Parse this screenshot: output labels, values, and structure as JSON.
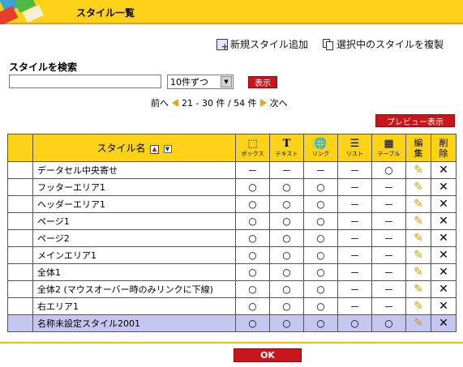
{
  "header": {
    "title": "スタイル一覧"
  },
  "top_links": {
    "add_new": "新規スタイル追加",
    "duplicate": "選択中のスタイルを複製"
  },
  "search": {
    "label": "スタイルを検索",
    "input_value": "",
    "per_page": "10件ずつ",
    "display_button": "表示"
  },
  "pager": {
    "prev": "前へ",
    "range": "21 - 30 件 / 54 件",
    "next": "次へ"
  },
  "preview_button": "プレビュー表示",
  "table": {
    "headers": {
      "name": "スタイル名",
      "box": "ボックス",
      "text": "テキスト",
      "link": "リンク",
      "list": "リスト",
      "table": "テーブル",
      "edit": "編集",
      "delete": "削除"
    },
    "rows": [
      {
        "name": "データセル中央寄せ",
        "box": "－",
        "text": "－",
        "link": "－",
        "list": "－",
        "table": "○"
      },
      {
        "name": "フッターエリア1",
        "box": "○",
        "text": "○",
        "link": "○",
        "list": "－",
        "table": "－"
      },
      {
        "name": "ヘッダーエリア1",
        "box": "○",
        "text": "○",
        "link": "○",
        "list": "－",
        "table": "－"
      },
      {
        "name": "ページ1",
        "box": "○",
        "text": "○",
        "link": "○",
        "list": "－",
        "table": "－"
      },
      {
        "name": "ページ2",
        "box": "○",
        "text": "○",
        "link": "○",
        "list": "－",
        "table": "－"
      },
      {
        "name": "メインエリア1",
        "box": "○",
        "text": "○",
        "link": "○",
        "list": "－",
        "table": "－"
      },
      {
        "name": "全体1",
        "box": "○",
        "text": "○",
        "link": "○",
        "list": "－",
        "table": "－"
      },
      {
        "name": "全体2 (マウスオーバー時のみリンクに下線)",
        "box": "○",
        "text": "○",
        "link": "○",
        "list": "－",
        "table": "－"
      },
      {
        "name": "右エリア1",
        "box": "○",
        "text": "○",
        "link": "○",
        "list": "－",
        "table": "－"
      },
      {
        "name": "名称未設定スタイル2001",
        "box": "○",
        "text": "○",
        "link": "○",
        "list": "○",
        "table": "○"
      }
    ]
  },
  "ok_button": "OK",
  "colors": {
    "header_yellow": "#ffd21a",
    "button_red": "#c8161b",
    "selected_row": "#c6c7f0"
  }
}
